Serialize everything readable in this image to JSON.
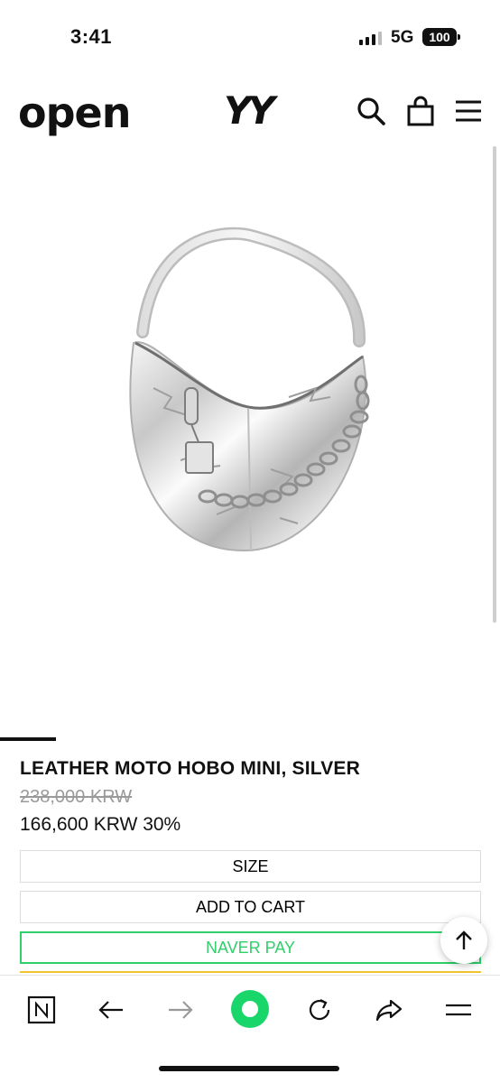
{
  "status_bar": {
    "time": "3:41",
    "network": "5G",
    "battery": "100"
  },
  "header": {
    "logo_left": "OPEN",
    "logo_center": "YY"
  },
  "product": {
    "title": "LEATHER MOTO HOBO MINI, SILVER",
    "original_price": "238,000 KRW",
    "sale_price": "166,600 KRW 30%"
  },
  "buttons": {
    "size": "SIZE",
    "add_to_cart": "ADD TO CART",
    "naver_pay": "NAVER PAY"
  },
  "browser_bar": {
    "icons": [
      "naver-n-icon",
      "back-arrow-icon",
      "forward-arrow-icon",
      "home-dot-icon",
      "refresh-icon",
      "share-icon",
      "menu-icon"
    ]
  },
  "colors": {
    "naver_green": "#2fd06a",
    "accent_yellow": "#f1c232"
  }
}
